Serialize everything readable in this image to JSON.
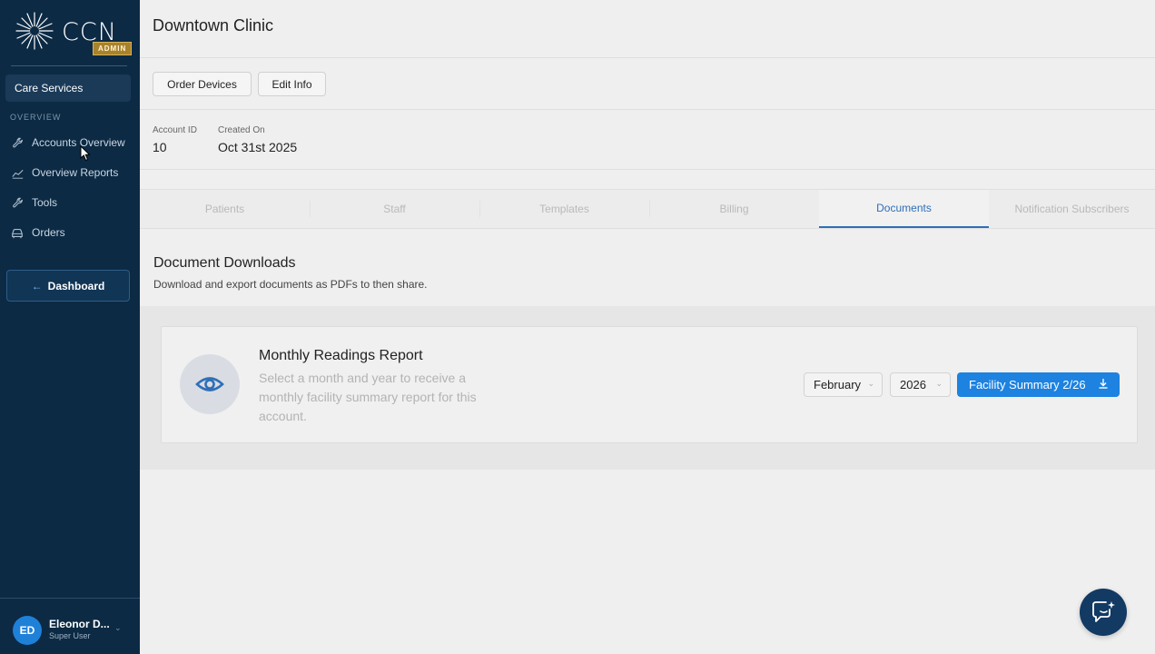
{
  "brand": {
    "name": "CCN",
    "badge": "ADMIN"
  },
  "sidebar": {
    "care_services": "Care Services",
    "section_label": "OVERVIEW",
    "items": [
      {
        "label": "Accounts Overview",
        "icon": "wrench-icon"
      },
      {
        "label": "Overview Reports",
        "icon": "line-chart-icon"
      },
      {
        "label": "Tools",
        "icon": "wrench-icon"
      },
      {
        "label": "Orders",
        "icon": "car-icon"
      }
    ],
    "dashboard_label": "Dashboard",
    "user": {
      "initials": "ED",
      "name": "Eleonor D...",
      "role": "Super User"
    }
  },
  "header": {
    "title": "Downtown Clinic"
  },
  "actions": {
    "order_devices": "Order Devices",
    "edit_info": "Edit Info"
  },
  "meta": {
    "account_id_label": "Account ID",
    "account_id": "10",
    "created_on_label": "Created On",
    "created_on": "Oct 31st 2025"
  },
  "tabs": [
    {
      "label": "Patients",
      "active": false
    },
    {
      "label": "Staff",
      "active": false
    },
    {
      "label": "Templates",
      "active": false
    },
    {
      "label": "Billing",
      "active": false
    },
    {
      "label": "Documents",
      "active": true
    },
    {
      "label": "Notification Subscribers",
      "active": false
    }
  ],
  "documents": {
    "title": "Document Downloads",
    "subtitle": "Download and export documents as PDFs to then share.",
    "card": {
      "title": "Monthly Readings Report",
      "description": "Select a month and year to receive a monthly facility summary report for this account.",
      "month": "February",
      "year": "2026",
      "button_label": "Facility Summary 2/26"
    }
  },
  "colors": {
    "sidebar": "#0c2a44",
    "accent": "#1d82e0",
    "active_tab": "#2f6fb7",
    "badge": "#a9822c"
  }
}
